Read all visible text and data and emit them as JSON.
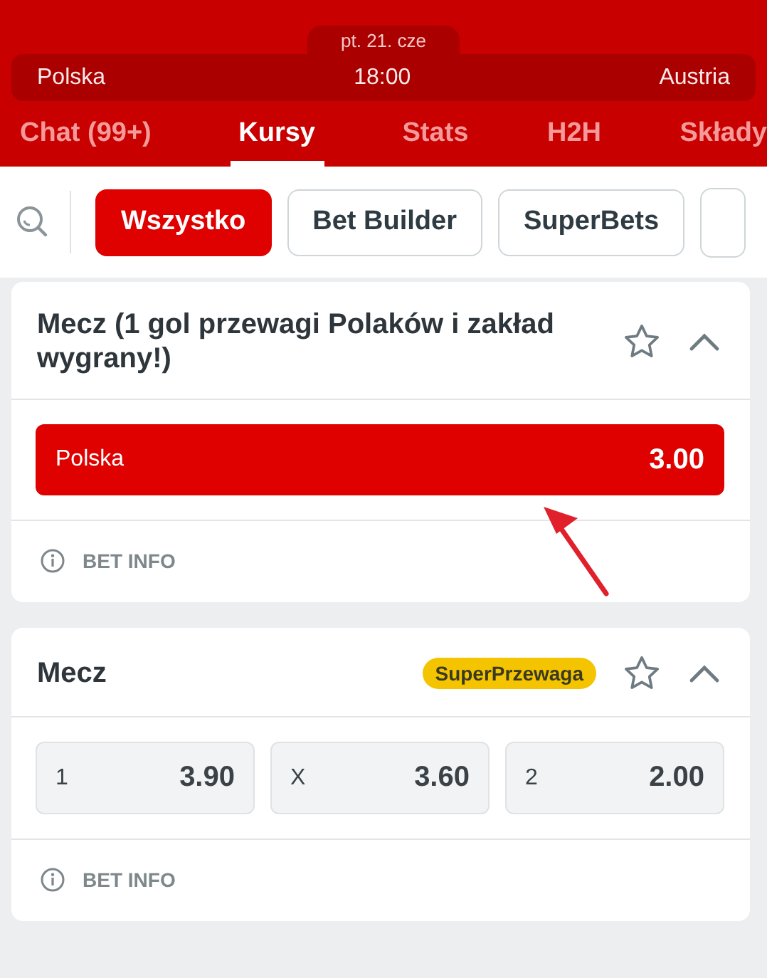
{
  "match": {
    "date": "pt. 21. cze",
    "home": "Polska",
    "time": "18:00",
    "away": "Austria"
  },
  "tabs": [
    {
      "label": "Chat (99+)",
      "selected": false
    },
    {
      "label": "Kursy",
      "selected": true
    },
    {
      "label": "Stats",
      "selected": false
    },
    {
      "label": "H2H",
      "selected": false
    },
    {
      "label": "Składy",
      "selected": false
    }
  ],
  "filters": [
    {
      "label": "Wszystko",
      "selected": true
    },
    {
      "label": "Bet Builder",
      "selected": false
    },
    {
      "label": "SuperBets",
      "selected": false
    }
  ],
  "markets": [
    {
      "title": "Mecz (1 gol przewagi Polaków i zakład wygrany!)",
      "outcomes": [
        {
          "label": "Polska",
          "odds": "3.00",
          "selected": true
        }
      ],
      "info": "BET INFO"
    },
    {
      "title": "Mecz",
      "badge": "SuperPrzewaga",
      "outcomes": [
        {
          "label": "1",
          "odds": "3.90",
          "selected": false
        },
        {
          "label": "X",
          "odds": "3.60",
          "selected": false
        },
        {
          "label": "2",
          "odds": "2.00",
          "selected": false
        }
      ],
      "info": "BET INFO"
    }
  ]
}
